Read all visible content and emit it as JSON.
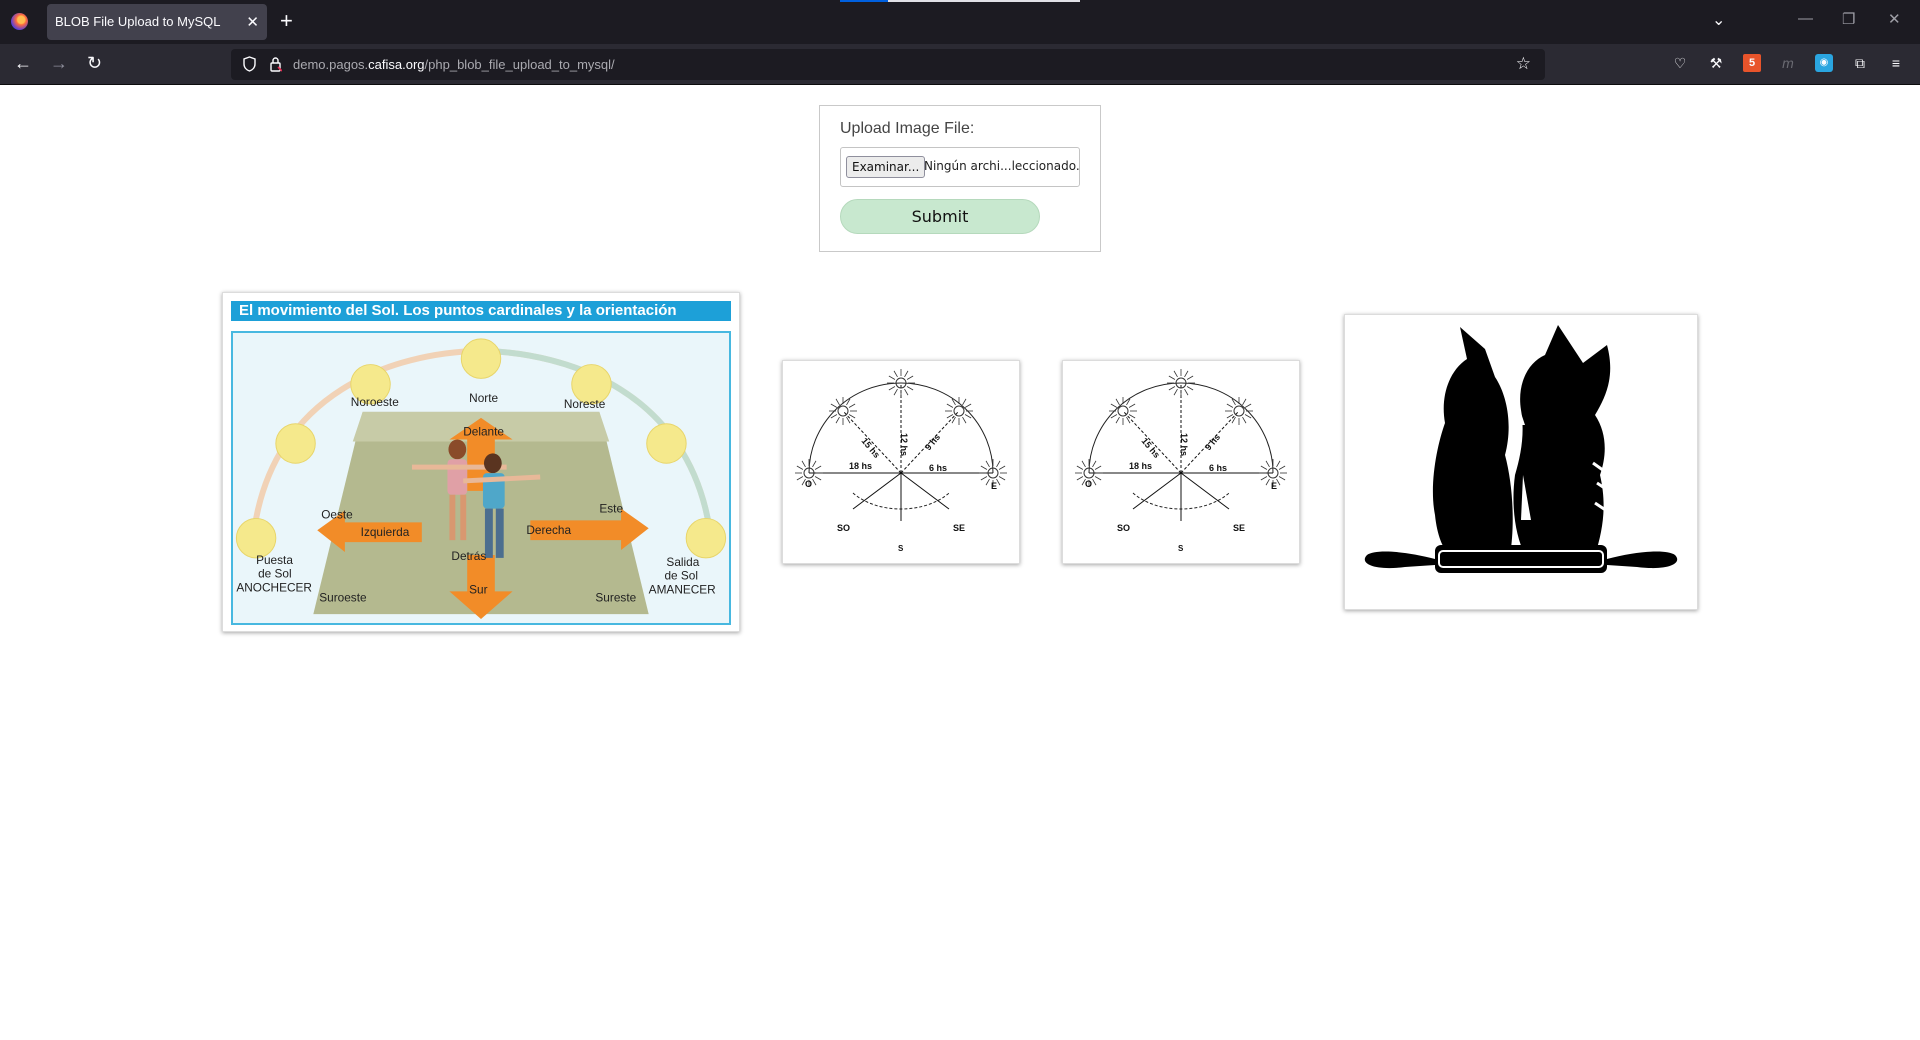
{
  "browser": {
    "tab_title": "BLOB File Upload to MySQL",
    "url_host_prefix": "demo.pagos.",
    "url_host_main": "cafisa.org",
    "url_path": "/php_blob_file_upload_to_mysql/",
    "icons": [
      "firefox-logo",
      "close-icon",
      "plus-icon",
      "chevron-down-icon",
      "back-icon",
      "forward-icon",
      "reload-icon",
      "shield-icon",
      "lock-icon",
      "star-icon",
      "pocket-icon",
      "wrench-icon",
      "extension-icons",
      "menu-icon"
    ]
  },
  "form": {
    "label": "Upload Image File:",
    "browse_label": "Examinar...",
    "file_status": "Ningún archi...leccionado.",
    "submit_label": "Submit"
  },
  "gallery": {
    "image1": {
      "title": "El movimiento del Sol. Los puntos cardinales y la orientación",
      "labels": {
        "norte": "Norte",
        "noroeste": "Noroeste",
        "noreste": "Noreste",
        "delante": "Delante",
        "oeste": "Oeste",
        "este": "Este",
        "izquierda": "Izquierda",
        "derecha": "Derecha",
        "detras": "Detrás",
        "sur": "Sur",
        "suroeste": "Suroeste",
        "sureste": "Sureste",
        "puesta1": "Puesta",
        "puesta2": "de Sol",
        "puesta3": "ANOCHECER",
        "salida1": "Salida",
        "salida2": "de Sol",
        "salida3": "AMANECER"
      }
    },
    "compass_labels": {
      "o": "O",
      "e": "E",
      "so": "SO",
      "se": "SE",
      "s": "S",
      "h12": "12 hs",
      "h15": "15 hs",
      "h9": "9 hs",
      "h18": "18 hs",
      "h6": "6 hs"
    },
    "image4": {
      "icon": "kittens-rolling-pin-silhouette"
    }
  },
  "colors": {
    "submit_bg": "#c8e8cf",
    "title_bar": "#1da0d8",
    "arrow": "#f28c28",
    "sun": "#f5e98c"
  }
}
